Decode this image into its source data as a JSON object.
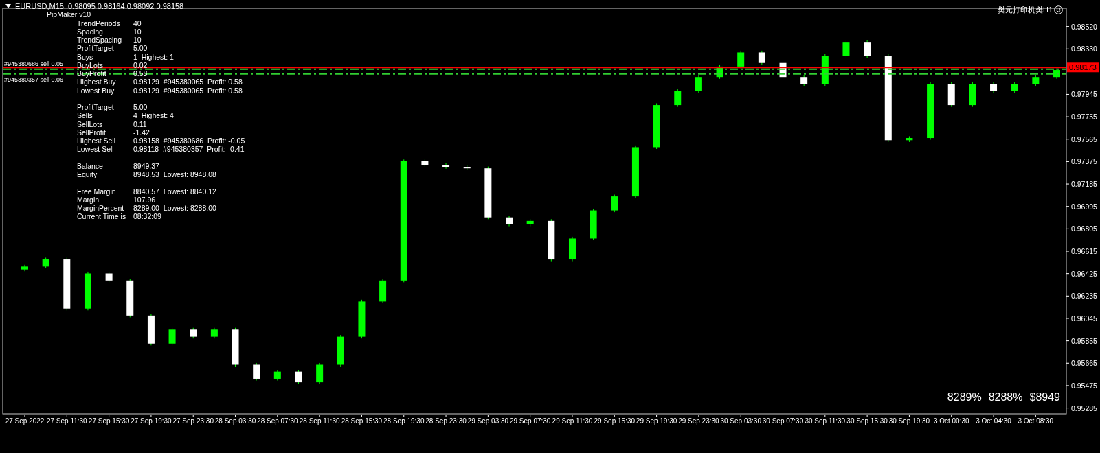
{
  "chart": {
    "header": {
      "symbol_line": "EURUSD,M15  0.98095 0.98164 0.98092 0.98158"
    },
    "indicator_label": "樊元打印机樊H1",
    "info_panel": {
      "title": "PipMaker v10",
      "sections": [
        {
          "rows": [
            {
              "label": "TrendPeriods",
              "value": "40"
            },
            {
              "label": "Spacing",
              "value": "10"
            },
            {
              "label": "TrendSpacing",
              "value": "10"
            },
            {
              "label": "ProfitTarget",
              "value": "5.00"
            },
            {
              "label": "Buys",
              "value": "1  Highest: 1"
            },
            {
              "label": "BuyLots",
              "value": "0.02"
            },
            {
              "label": "BuyProfit",
              "value": "0.58"
            },
            {
              "label": "Highest Buy",
              "value": "0.98129  #945380065  Profit: 0.58"
            },
            {
              "label": "Lowest Buy",
              "value": "0.98129  #945380065  Profit: 0.58"
            }
          ]
        },
        {
          "rows": [
            {
              "label": "ProfitTarget",
              "value": "5.00"
            },
            {
              "label": "Sells",
              "value": "4  Highest: 4"
            },
            {
              "label": "SellLots",
              "value": "0.11"
            },
            {
              "label": "SellProfit",
              "value": "-1.42"
            },
            {
              "label": "Highest Sell",
              "value": "0.98158  #945380686  Profit: -0.05"
            },
            {
              "label": "Lowest Sell",
              "value": "0.98118  #945380357  Profit: -0.41"
            }
          ]
        },
        {
          "rows": [
            {
              "label": "Balance",
              "value": "8949.37"
            },
            {
              "label": "Equity",
              "value": "8948.53  Lowest: 8948.08"
            }
          ]
        },
        {
          "rows": [
            {
              "label": "Free Margin",
              "value": "8840.57  Lowest: 8840.12"
            },
            {
              "label": "Margin",
              "value": "107.96"
            },
            {
              "label": "MarginPercent",
              "value": "8289.00  Lowest: 8288.00"
            },
            {
              "label": "Current Time is",
              "value": "08:32:09"
            }
          ]
        }
      ]
    },
    "summary": [
      "8289%",
      "8288%",
      "$8949"
    ],
    "chart_data": {
      "type": "candlestick",
      "categories": [
        "27 Sep 2022",
        null,
        "27 Sep 11:30",
        null,
        "27 Sep 15:30",
        null,
        "27 Sep 19:30",
        null,
        "27 Sep 23:30",
        null,
        "28 Sep 03:30",
        null,
        "28 Sep 07:30",
        null,
        "28 Sep 11:30",
        null,
        "28 Sep 15:30",
        null,
        "28 Sep 19:30",
        null,
        "28 Sep 23:30",
        null,
        "29 Sep 03:30",
        null,
        "29 Sep 07:30",
        null,
        "29 Sep 11:30",
        null,
        "29 Sep 15:30",
        null,
        "29 Sep 19:30",
        null,
        "29 Sep 23:30",
        null,
        "30 Sep 03:30",
        null,
        "30 Sep 07:30",
        null,
        "30 Sep 11:30",
        null,
        "30 Sep 15:30",
        null,
        "30 Sep 19:30",
        null,
        "3 Oct 00:30",
        null,
        "3 Oct 04:30",
        null,
        "3 Oct 08:30",
        null
      ],
      "ohlc": [
        [
          0.9646,
          0.965,
          0.96445,
          0.96485
        ],
        [
          0.96485,
          0.9656,
          0.9647,
          0.96545
        ],
        [
          0.96545,
          0.9656,
          0.96113,
          0.96128
        ],
        [
          0.96128,
          0.96441,
          0.96113,
          0.96426
        ],
        [
          0.96426,
          0.96441,
          0.96351,
          0.96366
        ],
        [
          0.96366,
          0.96381,
          0.96054,
          0.96069
        ],
        [
          0.96069,
          0.96084,
          0.95816,
          0.95831
        ],
        [
          0.95831,
          0.95965,
          0.95816,
          0.9595
        ],
        [
          0.9595,
          0.95965,
          0.95875,
          0.9589
        ],
        [
          0.9589,
          0.95965,
          0.95875,
          0.9595
        ],
        [
          0.9595,
          0.95965,
          0.95637,
          0.95652
        ],
        [
          0.95652,
          0.95667,
          0.95518,
          0.95533
        ],
        [
          0.95533,
          0.95608,
          0.95518,
          0.95593
        ],
        [
          0.95593,
          0.95608,
          0.95488,
          0.95503
        ],
        [
          0.95503,
          0.95667,
          0.95488,
          0.95652
        ],
        [
          0.95652,
          0.95905,
          0.95637,
          0.9589
        ],
        [
          0.9589,
          0.96203,
          0.95875,
          0.96188
        ],
        [
          0.96188,
          0.96381,
          0.96173,
          0.96366
        ],
        [
          0.96366,
          0.97393,
          0.96351,
          0.97378
        ],
        [
          0.97378,
          0.97393,
          0.97333,
          0.97348
        ],
        [
          0.97348,
          0.97363,
          0.97315,
          0.9733
        ],
        [
          0.9733,
          0.97345,
          0.97303,
          0.97318
        ],
        [
          0.97318,
          0.97333,
          0.96887,
          0.96902
        ],
        [
          0.96902,
          0.96917,
          0.96827,
          0.96842
        ],
        [
          0.96842,
          0.96887,
          0.96827,
          0.96872
        ],
        [
          0.96872,
          0.96887,
          0.9653,
          0.96545
        ],
        [
          0.96545,
          0.96738,
          0.9653,
          0.96723
        ],
        [
          0.96723,
          0.96976,
          0.96708,
          0.96961
        ],
        [
          0.96961,
          0.97095,
          0.96946,
          0.9708
        ],
        [
          0.9708,
          0.97512,
          0.97065,
          0.97497
        ],
        [
          0.97497,
          0.97869,
          0.97482,
          0.97854
        ],
        [
          0.97854,
          0.97988,
          0.97839,
          0.97973
        ],
        [
          0.97973,
          0.98107,
          0.97958,
          0.98092
        ],
        [
          0.98092,
          0.98196,
          0.98077,
          0.98181
        ],
        [
          0.98181,
          0.98315,
          0.98166,
          0.983
        ],
        [
          0.983,
          0.98315,
          0.98196,
          0.98211
        ],
        [
          0.98211,
          0.98226,
          0.98077,
          0.98092
        ],
        [
          0.98092,
          0.98107,
          0.98017,
          0.98032
        ],
        [
          0.98032,
          0.98285,
          0.98017,
          0.9827
        ],
        [
          0.9827,
          0.98404,
          0.98255,
          0.98389
        ],
        [
          0.98389,
          0.98404,
          0.98255,
          0.9827
        ],
        [
          0.9827,
          0.98285,
          0.97541,
          0.97556
        ],
        [
          0.97556,
          0.9759,
          0.97541,
          0.97575
        ],
        [
          0.97575,
          0.98047,
          0.9756,
          0.98032
        ],
        [
          0.98032,
          0.98047,
          0.97839,
          0.97854
        ],
        [
          0.97854,
          0.98047,
          0.97839,
          0.98032
        ],
        [
          0.98032,
          0.98047,
          0.97958,
          0.97973
        ],
        [
          0.97973,
          0.98047,
          0.97958,
          0.98032
        ],
        [
          0.98032,
          0.98107,
          0.98017,
          0.98092
        ],
        [
          0.98092,
          0.98166,
          0.98077,
          0.98151
        ]
      ],
      "ylim": [
        0.95236,
        0.98675
      ],
      "yticks": [
        {
          "value": 0.9852,
          "label": "0.98520"
        },
        {
          "value": 0.9833,
          "label": "0.98330"
        },
        {
          "value": 0.97945,
          "label": "0.97945"
        },
        {
          "value": 0.97755,
          "label": "0.97755"
        },
        {
          "value": 0.97565,
          "label": "0.97565"
        },
        {
          "value": 0.97375,
          "label": "0.97375"
        },
        {
          "value": 0.97185,
          "label": "0.97185"
        },
        {
          "value": 0.96995,
          "label": "0.96995"
        },
        {
          "value": 0.96805,
          "label": "0.96805"
        },
        {
          "value": 0.96615,
          "label": "0.96615"
        },
        {
          "value": 0.96425,
          "label": "0.96425"
        },
        {
          "value": 0.96235,
          "label": "0.96235"
        },
        {
          "value": 0.96045,
          "label": "0.96045"
        },
        {
          "value": 0.95855,
          "label": "0.95855"
        },
        {
          "value": 0.95665,
          "label": "0.95665"
        },
        {
          "value": 0.95475,
          "label": "0.95475"
        },
        {
          "value": 0.95285,
          "label": "0.95285"
        }
      ],
      "ref_lines": [
        {
          "axis": "y",
          "value": 0.98173,
          "label": "0.98173",
          "color": "#ff0000"
        },
        {
          "axis": "y",
          "value": 0.98158,
          "label": "#945380686 sell 0.05",
          "color": "#32cd32"
        },
        {
          "axis": "y",
          "value": 0.98118,
          "label": "#945380357 sell 0.06",
          "color": "#32cd32"
        }
      ]
    }
  }
}
